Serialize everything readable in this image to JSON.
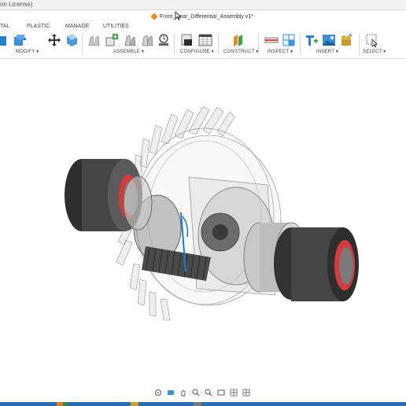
{
  "window": {
    "title_fragment": "on License)",
    "document_title": "Front_Rear_Differential_Assembly v1*"
  },
  "workspace_tabs": [
    "TAL",
    "PLASTIC",
    "MANAGE",
    "UTILITIES"
  ],
  "toolbar": {
    "groups": [
      "MODIFY ▾",
      "ASSEMBLE ▾",
      "CONFIGURE ▾",
      "CONSTRUCT ▾",
      "INSPECT ▾",
      "INSERT ▾",
      "SELECT ▾"
    ]
  },
  "icons": {
    "doc": "fusion-document-icon",
    "cursor": "mouse-cursor-icon"
  },
  "colors": {
    "accent_blue": "#1f7bd1",
    "housing_dark": "#3b3b3b",
    "seal_red": "#d63a3a",
    "bearing_grey": "#c8c8c8",
    "ghost_grey": "#9a9a9a"
  },
  "status_colors": [
    "#2c6cb0",
    "#2c6cb0",
    "#e07b20",
    "#3b8d3b",
    "#2c6cb0",
    "#d2a12a",
    "#2c6cb0",
    "#7a7a7a",
    "#2c6cb0"
  ]
}
